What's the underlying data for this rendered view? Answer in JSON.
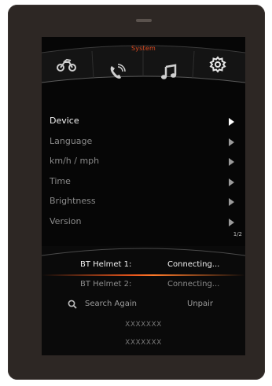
{
  "header": {
    "title": "System"
  },
  "tabs": [
    {
      "name": "motorcycle",
      "icon": "motorcycle-icon"
    },
    {
      "name": "phone",
      "icon": "phone-icon"
    },
    {
      "name": "music",
      "icon": "music-note-icon"
    },
    {
      "name": "settings",
      "icon": "gear-icon"
    }
  ],
  "menu": {
    "items": [
      {
        "label": "Device",
        "active": true
      },
      {
        "label": "Language"
      },
      {
        "label": "km/h / mph"
      },
      {
        "label": "Time"
      },
      {
        "label": "Brightness"
      },
      {
        "label": "Version"
      }
    ],
    "page_indicator": "1/2"
  },
  "bluetooth": {
    "helmet1": {
      "label": "BT Helmet 1:",
      "status": "Connecting..."
    },
    "helmet2": {
      "label": "BT Helmet 2:",
      "status": "Connecting..."
    },
    "search_label": "Search Again",
    "unpair_label": "Unpair",
    "codes": [
      "XXXXXXX",
      "XXXXXXX"
    ]
  },
  "colors": {
    "accent": "#e8561c",
    "screen_bg": "#060606",
    "bezel": "#2d2724"
  }
}
